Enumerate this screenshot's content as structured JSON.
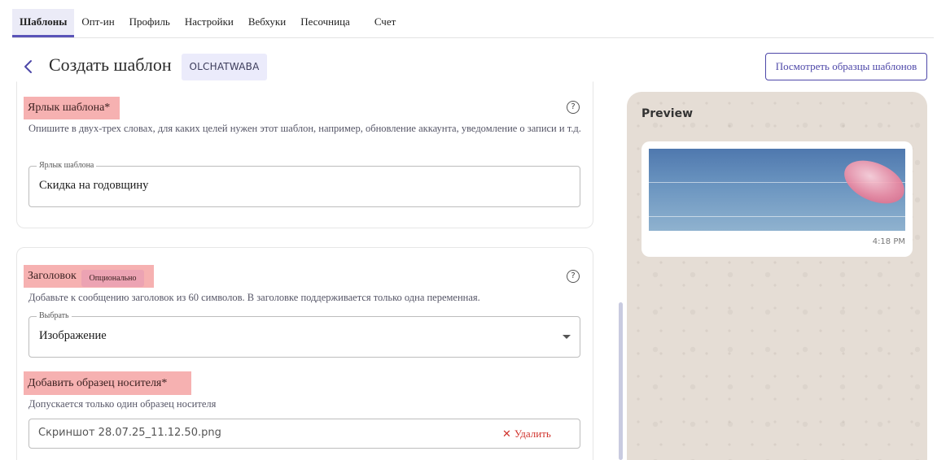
{
  "nav": {
    "tabs": [
      {
        "label": "Шаблоны",
        "active": true
      },
      {
        "label": "Опт-ин"
      },
      {
        "label": "Профиль"
      },
      {
        "label": "Настройки"
      },
      {
        "label": "Вебхуки"
      },
      {
        "label": "Песочница"
      },
      {
        "label": "Счет"
      }
    ]
  },
  "header": {
    "back_icon": "chevron-left-icon",
    "title": "Создать шаблон",
    "account": "OLCHATWABA",
    "view_samples_label": "Посмотреть образцы шаблонов"
  },
  "label_section": {
    "title": "Ярлык шаблона*",
    "help_icon": "help-circle-icon",
    "description": "Опишите в двух-трех словах, для каких целей нужен этот шаблон, например, обновление аккаунта, уведомление о записи и т.д.",
    "field_legend": "Ярлык шаблона",
    "field_value": "Скидка на годовщину"
  },
  "header_section": {
    "title": "Заголовок",
    "optional_badge": "Опционально",
    "help_icon": "help-circle-icon",
    "description": "Добавьте к сообщению заголовок из 60 символов. В заголовке поддерживается только одна переменная.",
    "select_legend": "Выбрать",
    "select_value": "Изображение",
    "media_title": "Добавить образец носителя*",
    "media_note": "Допускается только один образец носителя",
    "file_name": "Скриншот 28.07.25_11.12.50.png",
    "remove_label": "Удалить"
  },
  "preview": {
    "title": "Preview",
    "time": "4:18 PM"
  },
  "colors": {
    "accent": "#4d47a8",
    "highlight": "#f6b1b1",
    "danger": "#d0322b",
    "preview_bg": "#e5ddd5"
  }
}
